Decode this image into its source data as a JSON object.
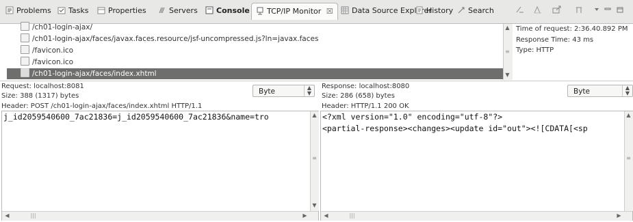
{
  "tabs": [
    {
      "label": "Problems",
      "icon": "problems-icon"
    },
    {
      "label": "Tasks",
      "icon": "tasks-icon"
    },
    {
      "label": "Properties",
      "icon": "properties-icon"
    },
    {
      "label": "Servers",
      "icon": "servers-icon"
    },
    {
      "label": "Console",
      "icon": "console-icon"
    },
    {
      "label": "TCP/IP Monitor",
      "icon": "tcpip-monitor-icon",
      "close": "☒"
    },
    {
      "label": "Data Source Explorer",
      "icon": "data-source-icon"
    },
    {
      "label": "History",
      "icon": "history-icon"
    },
    {
      "label": "Search",
      "icon": "search-icon"
    }
  ],
  "requests": [
    "/ch01-login-ajax/",
    "/ch01-login-ajax/faces/javax.faces.resource/jsf-uncompressed.js?ln=javax.faces",
    "/favicon.ico",
    "/favicon.ico",
    "/ch01-login-ajax/faces/index.xhtml"
  ],
  "info": {
    "time": "Time of request: 2:36.40.892 PM",
    "response_time": "Response Time: 43 ms",
    "type": "Type: HTTP"
  },
  "request_panel": {
    "title": "Request: localhost:8081",
    "size": "Size: 388 (1317) bytes",
    "header": "Header: POST /ch01-login-ajax/faces/index.xhtml HTTP/1.1",
    "format": "Byte",
    "content": "j_id2059540600_7ac21836=j_id2059540600_7ac21836&name=tro"
  },
  "response_panel": {
    "title": "Response: localhost:8080",
    "size": "Size: 286 (658) bytes",
    "header": "Header: HTTP/1.1 200 OK",
    "format": "Byte",
    "content_line1": "<?xml version=\"1.0\" encoding=\"utf-8\"?>",
    "content_line2": "<partial-response><changes><update id=\"out\"><![CDATA[<sp"
  },
  "colors": {
    "selected_row": "#6e6e6c",
    "tabbar": "#e8e8e6"
  }
}
